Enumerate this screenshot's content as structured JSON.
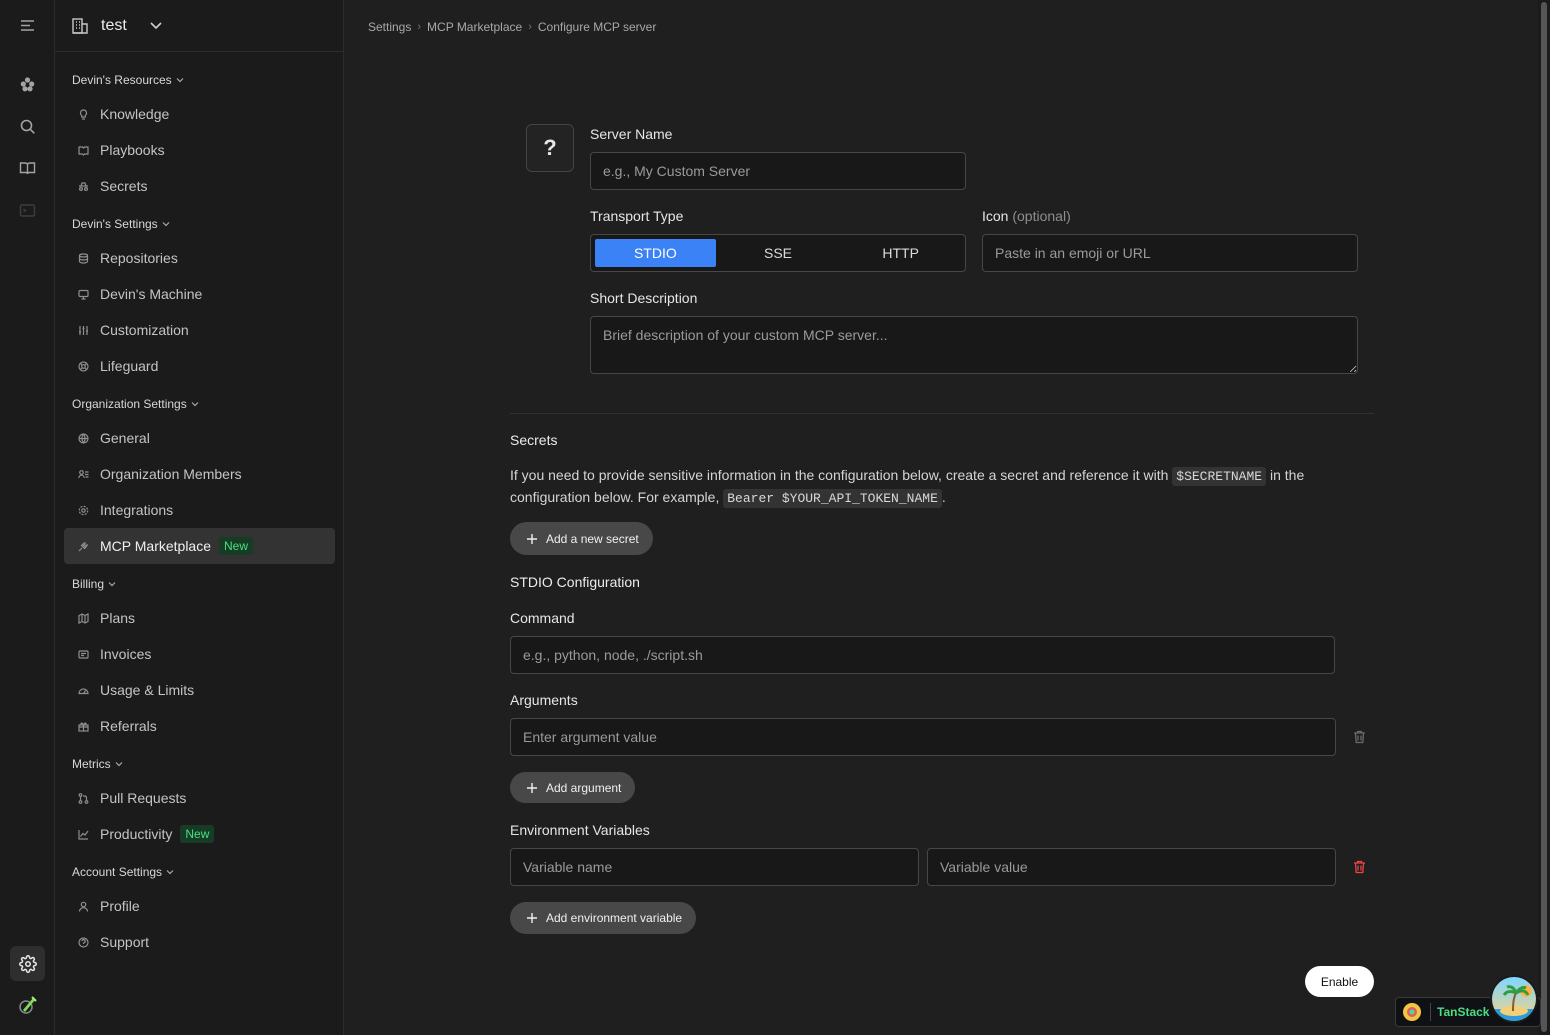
{
  "org": {
    "name": "test"
  },
  "sidebar": {
    "sections": [
      {
        "title": "Devin's Resources",
        "items": [
          "Knowledge",
          "Playbooks",
          "Secrets"
        ]
      },
      {
        "title": "Devin's Settings",
        "items": [
          "Repositories",
          "Devin's Machine",
          "Customization",
          "Lifeguard"
        ]
      },
      {
        "title": "Organization Settings",
        "items": [
          "General",
          "Organization Members",
          "Integrations",
          "MCP Marketplace"
        ]
      },
      {
        "title": "Billing",
        "items": [
          "Plans",
          "Invoices",
          "Usage & Limits",
          "Referrals"
        ]
      },
      {
        "title": "Metrics",
        "items": [
          "Pull Requests",
          "Productivity"
        ]
      },
      {
        "title": "Account Settings",
        "items": [
          "Profile",
          "Support"
        ]
      }
    ],
    "new_badge": "New",
    "active_item": "MCP Marketplace"
  },
  "breadcrumb": [
    "Settings",
    "MCP Marketplace",
    "Configure MCP server"
  ],
  "form": {
    "icon_placeholder_glyph": "?",
    "server_name": {
      "label": "Server Name",
      "value": "",
      "placeholder": "e.g., My Custom Server"
    },
    "transport": {
      "label": "Transport Type",
      "options": [
        "STDIO",
        "SSE",
        "HTTP"
      ],
      "selected": "STDIO"
    },
    "icon": {
      "label": "Icon",
      "optional": "(optional)",
      "value": "",
      "placeholder": "Paste in an emoji or URL"
    },
    "description": {
      "label": "Short Description",
      "value": "",
      "placeholder": "Brief description of your custom MCP server..."
    }
  },
  "secrets": {
    "title": "Secrets",
    "text_1": "If you need to provide sensitive information in the configuration below, create a secret and reference it with ",
    "code_1": "$SECRETNAME",
    "text_2": " in the configuration below. For example, ",
    "code_2": "Bearer $YOUR_API_TOKEN_NAME",
    "text_3": ".",
    "add_label": "Add a new secret"
  },
  "stdio": {
    "title": "STDIO Configuration",
    "command": {
      "label": "Command",
      "value": "",
      "placeholder": "e.g., python, node, ./script.sh"
    },
    "arguments": {
      "label": "Arguments",
      "value": "",
      "placeholder": "Enter argument value",
      "add_label": "Add argument"
    },
    "env": {
      "label": "Environment Variables",
      "name_placeholder": "Variable name",
      "value_placeholder": "Variable value",
      "add_label": "Add environment variable"
    }
  },
  "enable_label": "Enable",
  "devtools": {
    "label": "TanStack"
  }
}
